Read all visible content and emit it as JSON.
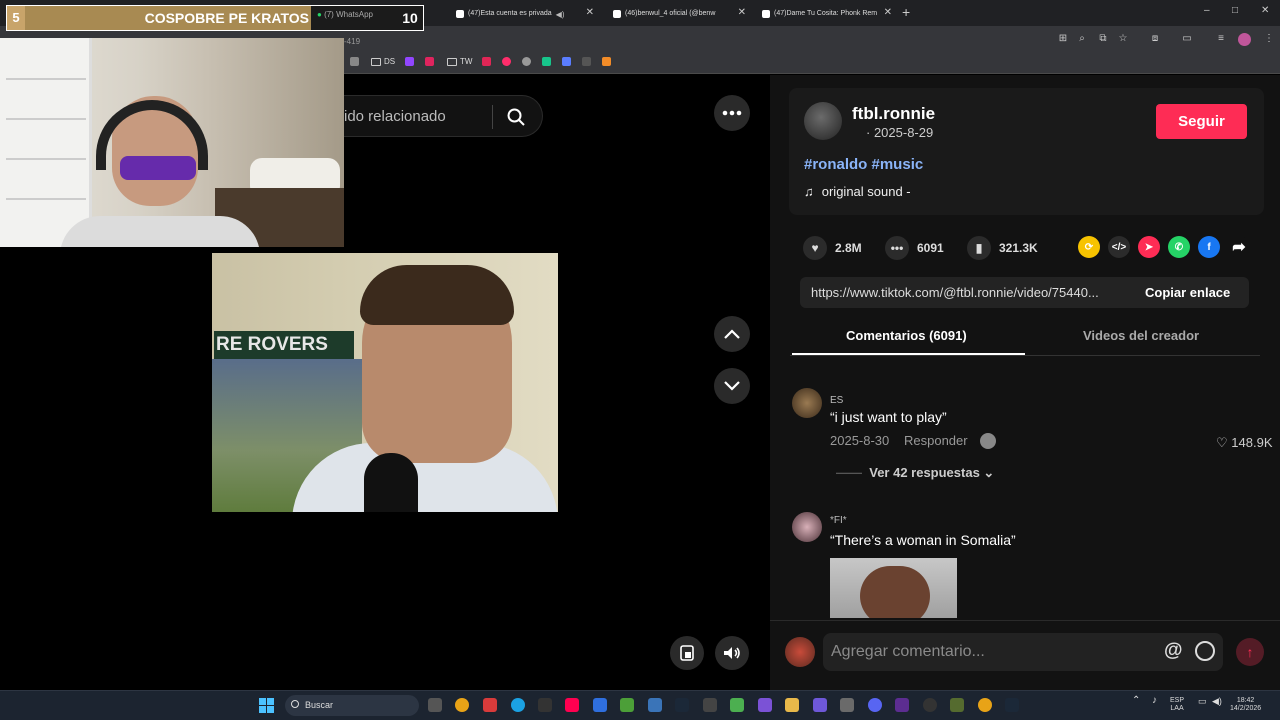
{
  "browser": {
    "tabs": [
      {
        "title": "(47)Esta cuenta es privada"
      },
      {
        "title": "(46)benwul_4 oficial (@benw"
      },
      {
        "title": "(47)Dame Tu Cosita: Phonk Rem"
      }
    ],
    "new_tab_label": "+",
    "window_controls": [
      "–",
      "□",
      "✕"
    ],
    "bookmarks": [
      "DS",
      "TW"
    ]
  },
  "overlay": {
    "left_number": "5",
    "title": "COSPOBRE PE KRATOS",
    "whatsapp_tab": "(7) WhatsApp",
    "right_number": "10",
    "partial_url_fragment": "-419"
  },
  "search": {
    "partial_text": "ido relacionado"
  },
  "video_sign": "RE  ROVERS",
  "post": {
    "author": "ftbl.ronnie",
    "date": "· 2025-8-29",
    "follow_label": "Seguir",
    "hashtags": "#ronaldo #music",
    "sound": "original sound -",
    "stats": {
      "likes": "2.8M",
      "comments": "6091",
      "saves": "321.3K"
    },
    "link_url": "https://www.tiktok.com/@ftbl.ronnie/video/75440...",
    "copy_label": "Copiar enlace"
  },
  "share_icons": [
    {
      "name": "repost-icon",
      "color": "#f7c300"
    },
    {
      "name": "embed-icon",
      "color": "#2b2b2b"
    },
    {
      "name": "send-icon",
      "color": "#fe2c55"
    },
    {
      "name": "whatsapp-icon",
      "color": "#25d366"
    },
    {
      "name": "facebook-icon",
      "color": "#1877f2"
    },
    {
      "name": "share-arrow-icon",
      "color": "#121212"
    }
  ],
  "tabs": {
    "comments": "Comentarios (6091)",
    "creator_videos": "Videos del creador"
  },
  "comments": [
    {
      "user": "ES",
      "text": "“i just want to play”",
      "date": "2025-8-30",
      "reply_label": "Responder",
      "likes": "148.9K",
      "view_replies": "Ver 42 respuestas"
    },
    {
      "user": "*FI*",
      "text": "“There’s a woman in Somalia”"
    }
  ],
  "comment_input": {
    "placeholder": "Agregar comentario..."
  },
  "taskbar": {
    "search_label": "Buscar",
    "lang_top": "ESP",
    "lang_bottom": "LAA",
    "time": "18:42",
    "date": "14/2/2026"
  }
}
